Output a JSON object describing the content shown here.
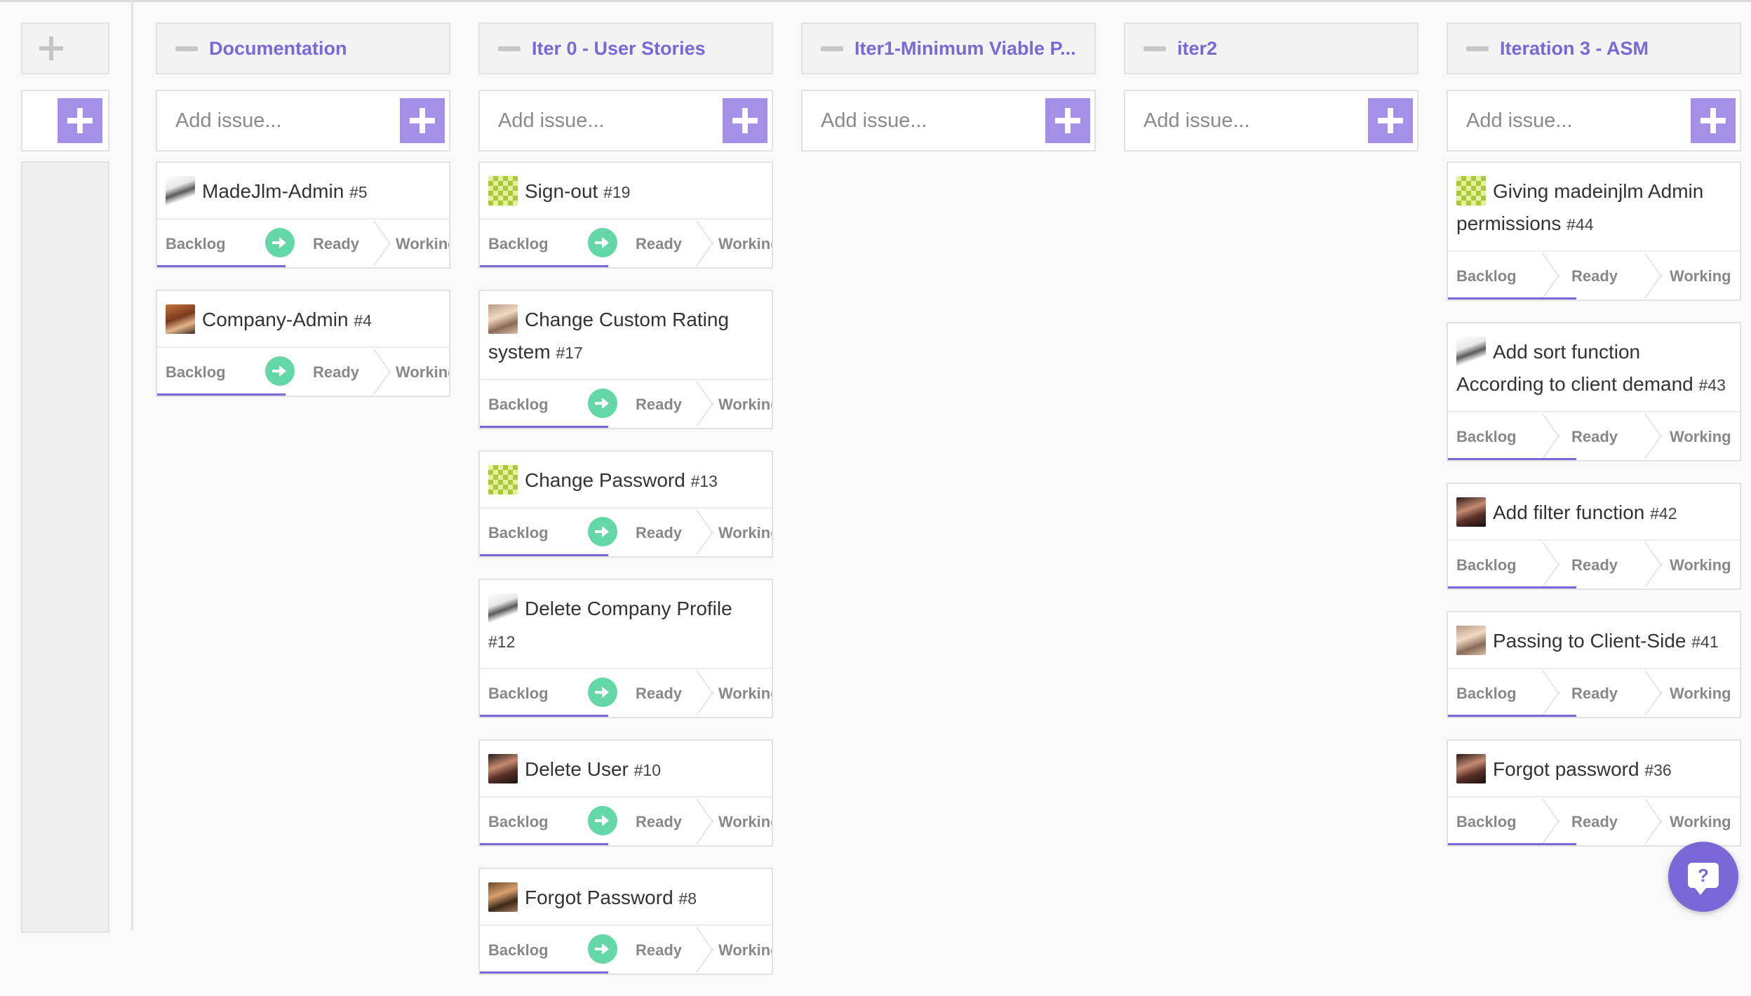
{
  "board": {
    "add_placeholder": "Add issue...",
    "help_symbol": "?",
    "columns": [
      {
        "title": "Documentation",
        "cards": [
          {
            "title": "MadeJlm-Admin",
            "number": "#5",
            "avatar": "sketch-avatar",
            "steps": [
              "Backlog",
              "Ready",
              "Working"
            ]
          },
          {
            "title": "Company-Admin",
            "number": "#4",
            "avatar": "photo-avatar",
            "steps": [
              "Backlog",
              "Ready",
              "Working"
            ]
          }
        ]
      },
      {
        "title": "Iter 0 - User Stories",
        "cards": [
          {
            "title": "Sign-out",
            "number": "#19",
            "avatar": "pattern-avatar",
            "steps": [
              "Backlog",
              "Ready",
              "Working"
            ]
          },
          {
            "title": "Change Custom Rating system",
            "number": "#17",
            "avatar": "photo-avatar",
            "steps": [
              "Backlog",
              "Ready",
              "Working"
            ]
          },
          {
            "title": "Change Password",
            "number": "#13",
            "avatar": "pattern-avatar",
            "steps": [
              "Backlog",
              "Ready",
              "Working"
            ]
          },
          {
            "title": "Delete Company Profile",
            "number": "#12",
            "avatar": "sketch-avatar",
            "steps": [
              "Backlog",
              "Ready",
              "Working"
            ]
          },
          {
            "title": "Delete User",
            "number": "#10",
            "avatar": "photo-avatar",
            "steps": [
              "Backlog",
              "Ready",
              "Working"
            ]
          },
          {
            "title": "Forgot Password",
            "number": "#8",
            "avatar": "photo-avatar",
            "steps": [
              "Backlog",
              "Ready",
              "Working"
            ]
          }
        ]
      },
      {
        "title": "Iter1-Minimum Viable P...",
        "cards": []
      },
      {
        "title": "iter2",
        "cards": []
      },
      {
        "title": "Iteration 3 - ASM",
        "cards": [
          {
            "title": "Giving madeinjlm Admin permissions",
            "number": "#44",
            "avatar": "pattern-avatar",
            "steps": [
              "Backlog",
              "Ready",
              "Working"
            ]
          },
          {
            "title": "Add sort function According to client demand",
            "number": "#43",
            "avatar": "sketch-avatar",
            "steps": [
              "Backlog",
              "Ready",
              "Working"
            ]
          },
          {
            "title": "Add filter function",
            "number": "#42",
            "avatar": "photo-avatar",
            "steps": [
              "Backlog",
              "Ready",
              "Working"
            ]
          },
          {
            "title": "Passing to Client-Side",
            "number": "#41",
            "avatar": "photo-avatar",
            "steps": [
              "Backlog",
              "Ready",
              "Working"
            ]
          },
          {
            "title": "Forgot password",
            "number": "#36",
            "avatar": "photo-avatar",
            "steps": [
              "Backlog",
              "Ready",
              "Working"
            ]
          }
        ]
      }
    ]
  }
}
